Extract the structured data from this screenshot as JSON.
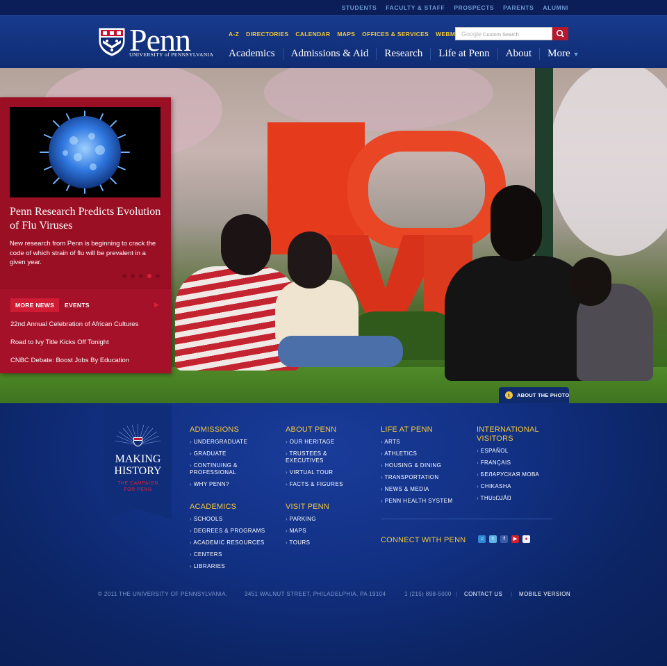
{
  "audience_nav": [
    "STUDENTS",
    "FACULTY & STAFF",
    "PROSPECTS",
    "PARENTS",
    "ALUMNI"
  ],
  "logo": {
    "word": "Penn",
    "sub": "UNIVERSITY of PENNSYLVANIA"
  },
  "utility_nav": [
    "A-Z",
    "DIRECTORIES",
    "CALENDAR",
    "MAPS",
    "OFFICES & SERVICES",
    "WEBMAIL"
  ],
  "search": {
    "brand": "Google",
    "placeholder": "Custom Search"
  },
  "main_nav": [
    "Academics",
    "Admissions & Aid",
    "Research",
    "Life at Penn",
    "About",
    "More"
  ],
  "feature": {
    "title": "Penn Research Predicts Evolution of Flu Viruses",
    "text": "New research from Penn is beginning to crack the code of which strain of flu will be prevalent in a given year.",
    "slides_total": 5,
    "active_slide": 4
  },
  "news": {
    "tabs": [
      "MORE NEWS",
      "EVENTS"
    ],
    "items": [
      "22nd Annual Celebration of African Cultures",
      "Road to Ivy Title Kicks Off Tonight",
      "CNBC Debate: Boost Jobs By Education"
    ]
  },
  "about_photo": "ABOUT THE PHOTO",
  "campaign": {
    "title_1": "MAKING",
    "title_2": "HISTORY",
    "subtitle_1": "THE CAMPAIGN",
    "subtitle_2": "FOR PENN"
  },
  "footer_columns": {
    "admissions": {
      "heading": "ADMISSIONS",
      "items": [
        "UNDERGRADUATE",
        "GRADUATE",
        "CONTINUING & PROFESSIONAL",
        "WHY PENN?"
      ]
    },
    "academics": {
      "heading": "ACADEMICS",
      "items": [
        "SCHOOLS",
        "DEGREES & PROGRAMS",
        "ACADEMIC RESOURCES",
        "CENTERS",
        "LIBRARIES"
      ]
    },
    "about_penn": {
      "heading": "ABOUT PENN",
      "items": [
        "OUR HERITAGE",
        "TRUSTEES & EXECUTIVES",
        "VIRTUAL TOUR",
        "FACTS & FIGURES"
      ]
    },
    "visit_penn": {
      "heading": "VISIT PENN",
      "items": [
        "PARKING",
        "MAPS",
        "TOURS"
      ]
    },
    "life_at_penn": {
      "heading": "LIFE AT PENN",
      "items": [
        "ARTS",
        "ATHLETICS",
        "HOUSING & DINING",
        "TRANSPORTATION",
        "NEWS & MEDIA",
        "PENN HEALTH SYSTEM"
      ]
    },
    "international": {
      "heading": "INTERNATIONAL VISITORS",
      "items": [
        "ESPAÑOL",
        "FRANÇAIS",
        "БЕЛАРУСКАЯ МОВА",
        "CHIKASHA",
        "THUɔŊJÄŊ"
      ]
    }
  },
  "connect_heading": "CONNECT WITH PENN",
  "social_icons": [
    "itunes-icon",
    "twitter-icon",
    "facebook-icon",
    "youtube-icon",
    "flickr-icon"
  ],
  "legal": {
    "copyright": "© 2011 THE UNIVERSITY OF PENNSYLVANIA.",
    "address": "3451 WALNUT STREET, PHILADELPHIA, PA 19104",
    "phone": "1 (215) 898-5000",
    "contact": "CONTACT US",
    "mobile": "MOBILE VERSION"
  },
  "colors": {
    "navy": "#0a2160",
    "penn_red": "#9b0f25",
    "gold": "#f4c83a",
    "link_blue": "#6e9ad6"
  }
}
